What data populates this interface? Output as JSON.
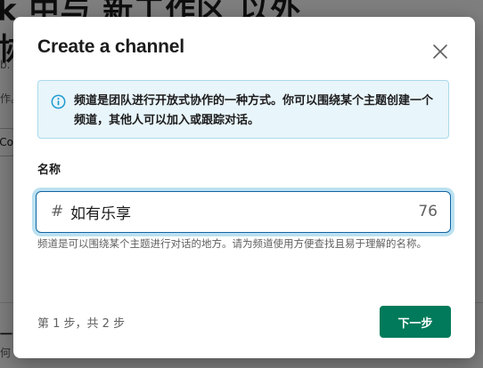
{
  "background": {
    "title_line1": "k 中与 新工作区 以外",
    "title_line2": "协",
    "small_text_1": "b.",
    "small_text_2": "作。",
    "button_label": "Co",
    "bottom_left_1": "一",
    "bottom_left_2": "何"
  },
  "modal": {
    "title": "Create a channel",
    "info": {
      "text": "频道是团队进行开放式协作的一种方式。你可以围绕某个主题创建一个频道，其他人可以加入或跟踪对话。"
    },
    "name_field": {
      "label": "名称",
      "prefix": "#",
      "value": "如有乐享",
      "remaining_chars": "76",
      "helper": "频道是可以围绕某个主题进行对话的地方。请为频道使用方便查找且易于理解的名称。"
    },
    "footer": {
      "step": "第 1 步，共 2 步",
      "next_label": "下一步"
    }
  },
  "colors": {
    "accent": "#007a5a",
    "focus": "#1264a3",
    "info_bg": "#e8f5fa",
    "info_icon": "#1d9bd1"
  }
}
